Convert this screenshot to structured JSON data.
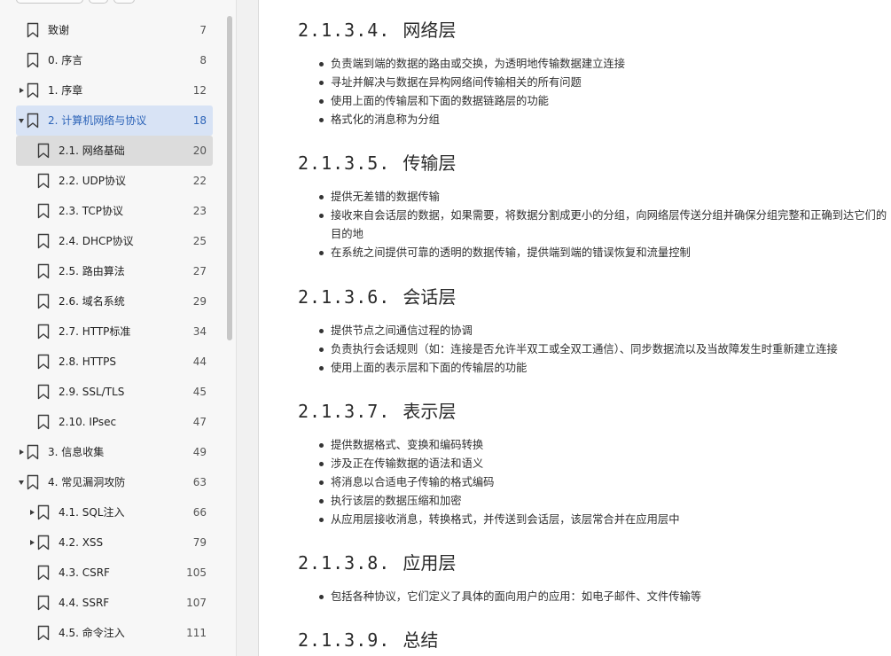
{
  "toc": [
    {
      "label": "致谢",
      "page": "7",
      "level": 0,
      "state": "none",
      "selected": false,
      "current": false
    },
    {
      "label": "0. 序言",
      "page": "8",
      "level": 0,
      "state": "none",
      "selected": false,
      "current": false
    },
    {
      "label": "1. 序章",
      "page": "12",
      "level": 0,
      "state": "collapsed",
      "selected": false,
      "current": false
    },
    {
      "label": "2. 计算机网络与协议",
      "page": "18",
      "level": 0,
      "state": "expanded",
      "selected": false,
      "current": true
    },
    {
      "label": "2.1. 网络基础",
      "page": "20",
      "level": 1,
      "state": "none",
      "selected": true,
      "current": false
    },
    {
      "label": "2.2. UDP协议",
      "page": "22",
      "level": 1,
      "state": "none",
      "selected": false,
      "current": false
    },
    {
      "label": "2.3. TCP协议",
      "page": "23",
      "level": 1,
      "state": "none",
      "selected": false,
      "current": false
    },
    {
      "label": "2.4. DHCP协议",
      "page": "25",
      "level": 1,
      "state": "none",
      "selected": false,
      "current": false
    },
    {
      "label": "2.5. 路由算法",
      "page": "27",
      "level": 1,
      "state": "none",
      "selected": false,
      "current": false
    },
    {
      "label": "2.6. 域名系统",
      "page": "29",
      "level": 1,
      "state": "none",
      "selected": false,
      "current": false
    },
    {
      "label": "2.7. HTTP标准",
      "page": "34",
      "level": 1,
      "state": "none",
      "selected": false,
      "current": false
    },
    {
      "label": "2.8. HTTPS",
      "page": "44",
      "level": 1,
      "state": "none",
      "selected": false,
      "current": false
    },
    {
      "label": "2.9. SSL/TLS",
      "page": "45",
      "level": 1,
      "state": "none",
      "selected": false,
      "current": false
    },
    {
      "label": "2.10. IPsec",
      "page": "47",
      "level": 1,
      "state": "none",
      "selected": false,
      "current": false
    },
    {
      "label": "3. 信息收集",
      "page": "49",
      "level": 0,
      "state": "collapsed",
      "selected": false,
      "current": false
    },
    {
      "label": "4. 常见漏洞攻防",
      "page": "63",
      "level": 0,
      "state": "expanded",
      "selected": false,
      "current": false
    },
    {
      "label": "4.1. SQL注入",
      "page": "66",
      "level": 1,
      "state": "collapsed",
      "selected": false,
      "current": false
    },
    {
      "label": "4.2. XSS",
      "page": "79",
      "level": 1,
      "state": "collapsed",
      "selected": false,
      "current": false
    },
    {
      "label": "4.3. CSRF",
      "page": "105",
      "level": 1,
      "state": "none",
      "selected": false,
      "current": false
    },
    {
      "label": "4.4. SSRF",
      "page": "107",
      "level": 1,
      "state": "none",
      "selected": false,
      "current": false
    },
    {
      "label": "4.5. 命令注入",
      "page": "111",
      "level": 1,
      "state": "none",
      "selected": false,
      "current": false
    }
  ],
  "sections": [
    {
      "number": "2.1.3.4.",
      "title": "网络层",
      "bullets": [
        "负责端到端的数据的路由或交换，为透明地传输数据建立连接",
        "寻址并解决与数据在异构网络间传输相关的所有问题",
        "使用上面的传输层和下面的数据链路层的功能",
        "格式化的消息称为分组"
      ]
    },
    {
      "number": "2.1.3.5.",
      "title": "传输层",
      "bullets": [
        "提供无差错的数据传输",
        "接收来自会话层的数据，如果需要，将数据分割成更小的分组，向网络层传送分组并确保分组完整和正确到达它们的目的地",
        "在系统之间提供可靠的透明的数据传输，提供端到端的错误恢复和流量控制"
      ]
    },
    {
      "number": "2.1.3.6.",
      "title": "会话层",
      "bullets": [
        "提供节点之间通信过程的协调",
        "负责执行会话规则（如：连接是否允许半双工或全双工通信）、同步数据流以及当故障发生时重新建立连接",
        "使用上面的表示层和下面的传输层的功能"
      ]
    },
    {
      "number": "2.1.3.7.",
      "title": "表示层",
      "bullets": [
        "提供数据格式、变换和编码转换",
        "涉及正在传输数据的语法和语义",
        "将消息以合适电子传输的格式编码",
        "执行该层的数据压缩和加密",
        "从应用层接收消息，转换格式，并传送到会话层，该层常合并在应用层中"
      ]
    },
    {
      "number": "2.1.3.8.",
      "title": "应用层",
      "bullets": [
        "包括各种协议，它们定义了具体的面向用户的应用：如电子邮件、文件传输等"
      ]
    },
    {
      "number": "2.1.3.9.",
      "title": "总结",
      "bullets": []
    }
  ]
}
